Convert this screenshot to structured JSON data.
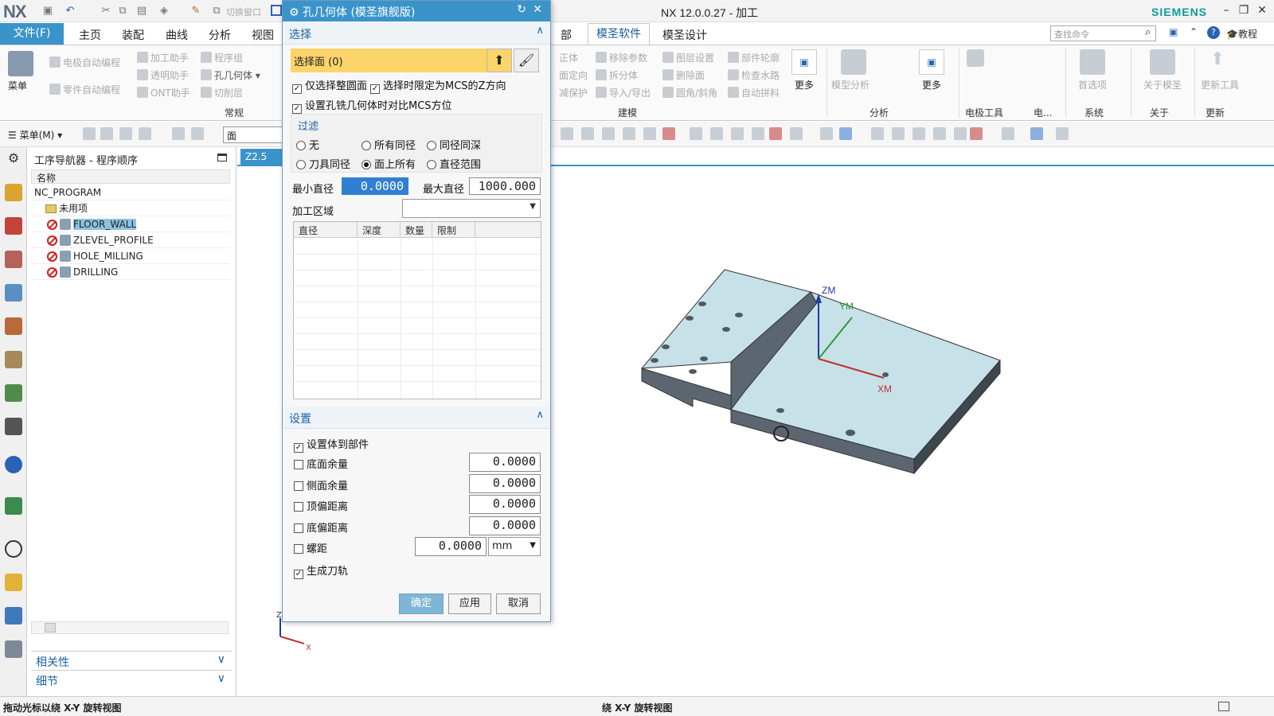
{
  "app": {
    "logo": "NX",
    "window_title": "NX 12.0.0.27 - 加工",
    "brand": "SIEMENS",
    "quick_toolbar": [
      "切换窗口"
    ]
  },
  "ribbon_tabs": {
    "file": "文件(F)",
    "tabs": [
      "主页",
      "装配",
      "曲线",
      "分析",
      "视图"
    ],
    "right_tabs": [
      "部",
      "模圣软件",
      "模圣设计"
    ],
    "active": "模圣软件",
    "search_placeholder": "查找命令",
    "help_label": "教程"
  },
  "ribbon": {
    "menu_label": "菜单",
    "left_group": {
      "items": [
        "电极自动编程",
        "加工助手",
        "程序组",
        "透明助手",
        "孔几何体",
        "零件自动编程",
        "ONT助手",
        "切削层"
      ],
      "group_label": "常规"
    },
    "model_group": {
      "items": [
        "正体",
        "移除参数",
        "图层设置",
        "部件轮廓",
        "面定向",
        "拆分体",
        "删除面",
        "检查水路",
        "减保护",
        "导入/导出",
        "圆角/斜角",
        "自动拼料"
      ],
      "more": "更多",
      "group_label": "建模"
    },
    "analysis_group": {
      "items": [
        "模型分析"
      ],
      "more": "更多",
      "group_label": "分析"
    },
    "electrode_label": "电极工具",
    "electrode_short": "电...",
    "system": {
      "items": [
        "首选项"
      ],
      "label": "系统"
    },
    "about": {
      "items": [
        "关于模圣"
      ],
      "label": "关于"
    },
    "update": {
      "items": [
        "更新工具"
      ],
      "label": "更新"
    }
  },
  "cmdbar": {
    "menu": "菜单(M)",
    "select_filter": "面"
  },
  "navigator": {
    "title": "工序导航器 - 程序顺序",
    "column": "名称",
    "rows": [
      {
        "name": "NC_PROGRAM"
      },
      {
        "name": "未用项"
      },
      {
        "name": "FLOOR_WALL"
      },
      {
        "name": "ZLEVEL_PROFILE"
      },
      {
        "name": "HOLE_MILLING"
      },
      {
        "name": "DRILLING"
      }
    ],
    "panel_related": "相关性",
    "panel_details": "细节"
  },
  "viewport": {
    "tab": "Z2.5",
    "axes": {
      "zm": "ZM",
      "ym": "YM",
      "xm": "XM",
      "triad_z": "Z",
      "triad_x": "X"
    }
  },
  "dialog": {
    "title": "孔几何体 (模圣旗舰版)",
    "select_section": "选择",
    "select_face": "选择面 (0)",
    "opt1": "仅选择整圆面",
    "opt2": "选择时限定为MCS的Z方向",
    "opt3": "设置孔铣几何体时对比MCS方位",
    "filter_title": "过滤",
    "filters": [
      "无",
      "所有同径",
      "同径同深",
      "刀具同径",
      "面上所有",
      "直径范围"
    ],
    "filter_selected": "面上所有",
    "min_dia_label": "最小直径",
    "min_dia": "0.0000",
    "max_dia_label": "最大直径",
    "max_dia": "1000.000",
    "region_label": "加工区域",
    "grid_cols": [
      "直径",
      "深度",
      "数量",
      "限制"
    ],
    "settings_section": "设置",
    "set_to_part": "设置体到部件",
    "floor_stock": "底面余量",
    "floor_stock_val": "0.0000",
    "side_stock": "侧面余量",
    "side_stock_val": "0.0000",
    "top_offset": "顶偏距离",
    "top_offset_val": "0.0000",
    "bottom_offset": "底偏距离",
    "bottom_offset_val": "0.0000",
    "pitch": "螺距",
    "pitch_val": "0.0000",
    "unit": "mm",
    "gen_path": "生成刀轨",
    "ok": "确定",
    "apply": "应用",
    "cancel": "取消"
  },
  "status": {
    "left": "拖动光标以绕 X-Y 旋转视图",
    "center": "绕 X-Y 旋转视图"
  }
}
